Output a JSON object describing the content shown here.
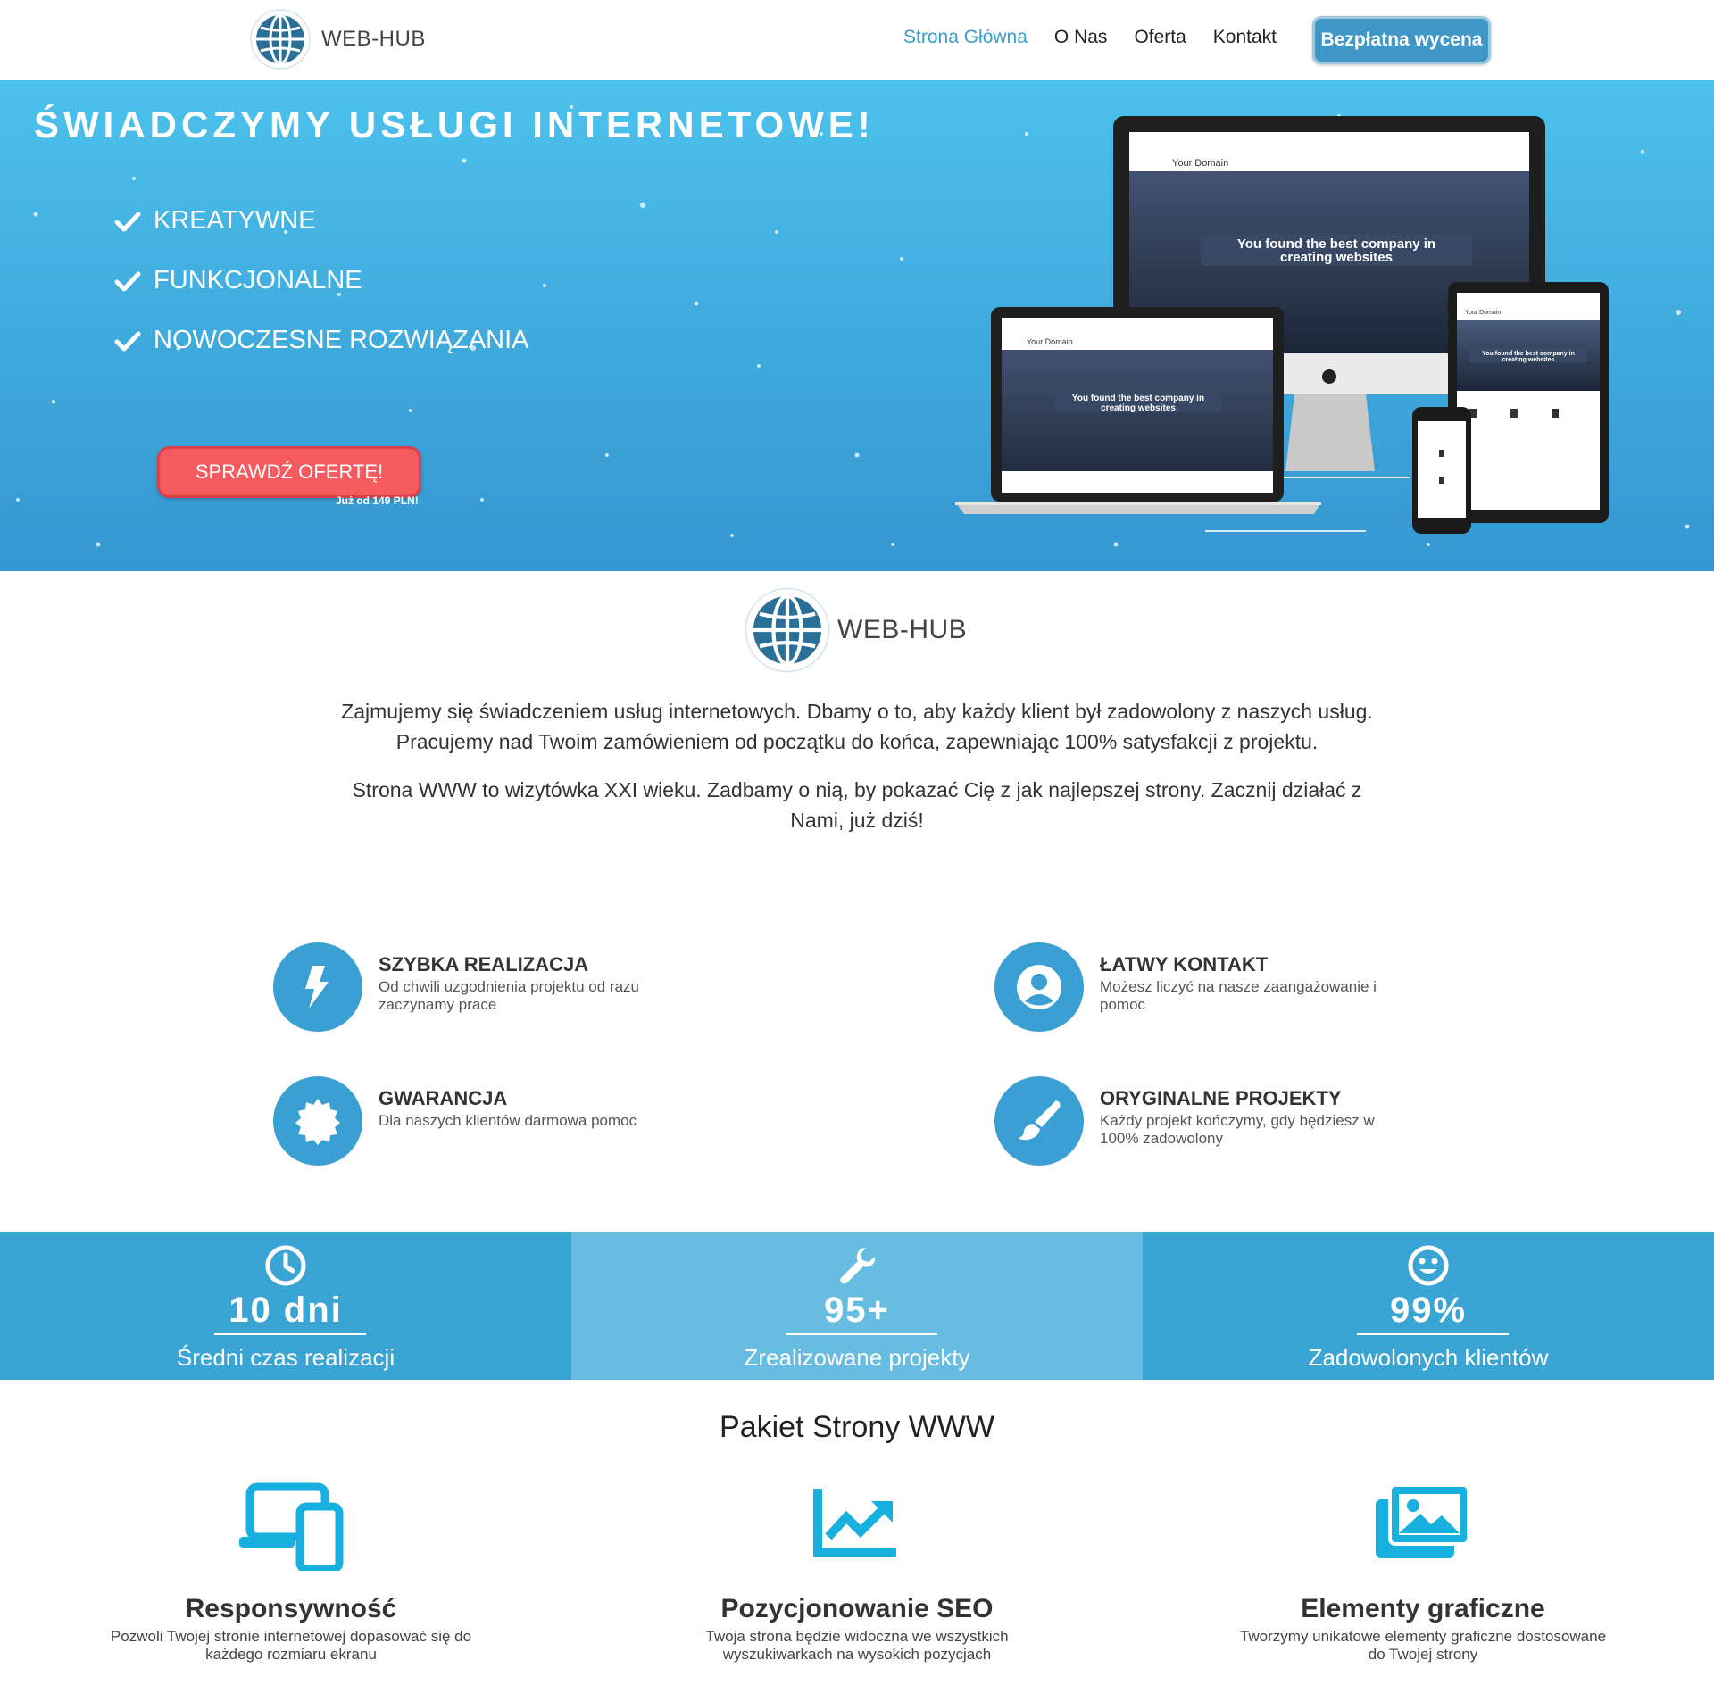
{
  "brand": {
    "name": "WEB-HUB",
    "logo_icon": "globe-icon"
  },
  "nav": {
    "links": [
      "Strona Główna",
      "O Nas",
      "Oferta",
      "Kontakt"
    ],
    "cta": "Bezpłatna wycena"
  },
  "hero": {
    "title": "ŚWIADCZYMY USŁUGI INTERNETOWE!",
    "items": [
      "KREATYWNE",
      "FUNKCJONALNE",
      "NOWOCZESNE ROZWIĄZANIA"
    ],
    "button": "SPRAWDŹ OFERTĘ!",
    "price_note": "Już od 149 PLN!",
    "mockup": {
      "domain": "Your Domain",
      "headline_line1": "You found the best company in",
      "headline_line2": "creating websites"
    }
  },
  "about": {
    "paragraph1": "Zajmujemy się świadczeniem usług internetowych. Dbamy o to, aby każdy klient był zadowolony z naszych usług. Pracujemy nad Twoim zamówieniem od początku do końca, zapewniając 100% satysfakcji z projektu.",
    "paragraph2": "Strona WWW to wizytówka XXI wieku. Zadbamy o nią, by pokazać Cię z jak najlepszej strony. Zacznij działać z Nami, już dziś!"
  },
  "features": [
    {
      "title": "SZYBKA REALIZACJA",
      "desc": "Od chwili uzgodnienia projektu od razu zaczynamy prace",
      "icon": "bolt-icon"
    },
    {
      "title": "ŁATWY KONTAKT",
      "desc": "Możesz liczyć na nasze zaangażowanie i pomoc",
      "icon": "user-circle-icon"
    },
    {
      "title": "GWARANCJA",
      "desc": "Dla naszych klientów darmowa pomoc",
      "icon": "badge-icon"
    },
    {
      "title": "ORYGINALNE PROJEKTY",
      "desc": "Każdy projekt kończymy, gdy będziesz w 100% zadowolony",
      "icon": "brush-icon"
    }
  ],
  "stats": [
    {
      "value": "10 dni",
      "label": "Średni czas realizacji",
      "icon": "clock-icon"
    },
    {
      "value": "95+",
      "label": "Zrealizowane projekty",
      "icon": "wrench-icon"
    },
    {
      "value": "99%",
      "label": "Zadowolonych klientów",
      "icon": "smile-icon"
    }
  ],
  "package": {
    "title": "Pakiet Strony WWW",
    "items": [
      {
        "title": "Responsywność",
        "desc": "Pozwoli Twojej stronie internetowej dopasować się do każdego rozmiaru ekranu",
        "icon": "devices-icon"
      },
      {
        "title": "Pozycjonowanie SEO",
        "desc": "Twoja strona będzie widoczna we wszystkich wyszukiwarkach na wysokich pozycjach",
        "icon": "chart-up-icon"
      },
      {
        "title": "Elementy graficzne",
        "desc": "Tworzymy unikatowe elementy graficzne dostosowane do Twojej strony",
        "icon": "images-icon"
      }
    ]
  },
  "colors": {
    "accent": "#3a9fd3",
    "hero_top": "#4cc1ec",
    "cta_red": "#f55a5f",
    "stat_light": "#67bde1",
    "package_icon": "#17b0df"
  }
}
